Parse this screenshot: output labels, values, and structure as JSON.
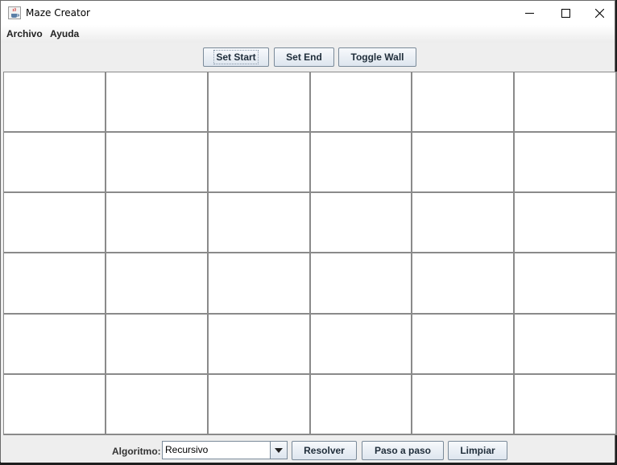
{
  "window": {
    "title": "Maze Creator",
    "minimize_icon": "minimize-icon",
    "maximize_icon": "maximize-icon",
    "close_icon": "close-icon",
    "app_icon": "java-coffee-cup-icon"
  },
  "menubar": {
    "items": [
      "Archivo",
      "Ayuda"
    ]
  },
  "toolbar": {
    "set_start": "Set Start",
    "set_end": "Set End",
    "toggle_wall": "Toggle Wall",
    "focused": "Set Start"
  },
  "maze": {
    "rows": 6,
    "cols": 6,
    "cell_color": "#ffffff",
    "line_color": "#8a8a8a"
  },
  "bottom": {
    "algorithm_label": "Algoritmo:",
    "algorithm_value": "Recursivo",
    "solve": "Resolver",
    "step": "Paso a paso",
    "clear": "Limpiar"
  }
}
